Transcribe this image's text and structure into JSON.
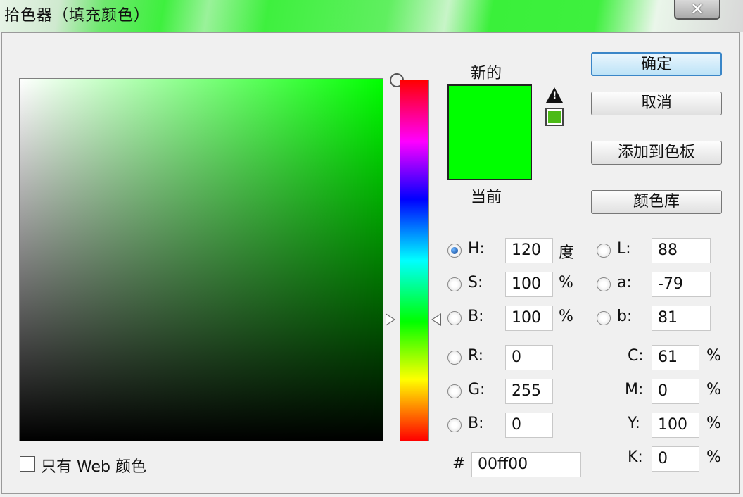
{
  "window": {
    "title": "拾色器（填充颜色）",
    "close_glyph": "✕"
  },
  "swatch": {
    "new_label": "新的",
    "current_label": "当前",
    "new_color": "#00ff00",
    "current_color": "#00ff00",
    "gamut_color": "#4cbb17",
    "warning_glyph": "!"
  },
  "buttons": {
    "ok": "确定",
    "cancel": "取消",
    "add_to_swatches": "添加到色板",
    "color_libraries": "颜色库"
  },
  "hsb": {
    "h": {
      "label": "H:",
      "value": "120",
      "unit": "度"
    },
    "s": {
      "label": "S:",
      "value": "100",
      "unit": "%"
    },
    "b": {
      "label": "B:",
      "value": "100",
      "unit": "%"
    }
  },
  "rgb": {
    "r": {
      "label": "R:",
      "value": "0"
    },
    "g": {
      "label": "G:",
      "value": "255"
    },
    "b": {
      "label": "B:",
      "value": "0"
    }
  },
  "lab": {
    "l": {
      "label": "L:",
      "value": "88"
    },
    "a": {
      "label": "a:",
      "value": "-79"
    },
    "b": {
      "label": "b:",
      "value": "81"
    }
  },
  "cmyk": {
    "c": {
      "label": "C:",
      "value": "61",
      "unit": "%"
    },
    "m": {
      "label": "M:",
      "value": "0",
      "unit": "%"
    },
    "y": {
      "label": "Y:",
      "value": "100",
      "unit": "%"
    },
    "k": {
      "label": "K:",
      "value": "0",
      "unit": "%"
    }
  },
  "hex": {
    "label": "#",
    "value": "00ff00"
  },
  "web_only": {
    "label": "只有 Web 颜色",
    "checked": false
  },
  "selected_mode": "H"
}
